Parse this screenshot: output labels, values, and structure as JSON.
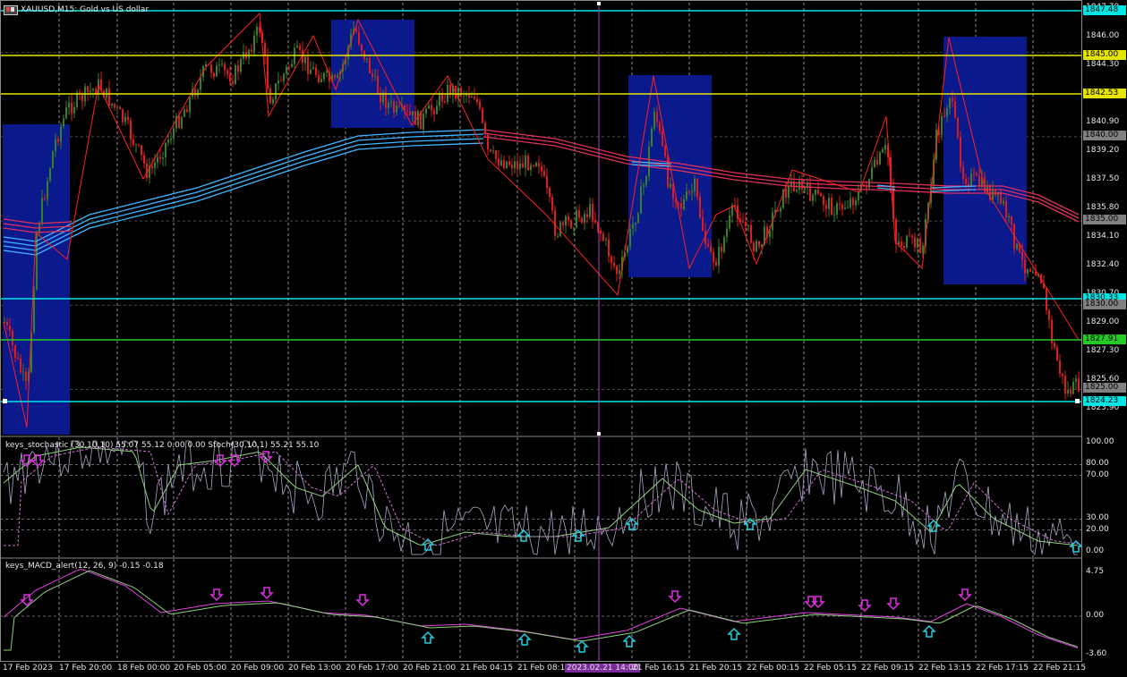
{
  "window": {
    "title": "XAUUSD,M15: Gold vs US dollar",
    "menu_icon": "chart-window-icon"
  },
  "main_axis": {
    "ticks": [
      "1847.70",
      "1846.00",
      "1844.30",
      "1842.60",
      "1840.90",
      "1839.20",
      "1837.50",
      "1835.80",
      "1834.10",
      "1832.40",
      "1830.70",
      "1829.00",
      "1827.30",
      "1825.60",
      "1823.90"
    ]
  },
  "price_lines": [
    {
      "label": "1847.48",
      "color": "#00e5e5"
    },
    {
      "label": "1845.00",
      "color": "#e5e500"
    },
    {
      "label": "1842.53",
      "color": "#e5e500"
    },
    {
      "label": "1840.00",
      "color": "#808080"
    },
    {
      "label": "1835.00",
      "color": "#808080"
    },
    {
      "label": "1830.33",
      "color": "#00e5e5"
    },
    {
      "label": "1830.00",
      "color": "#808080"
    },
    {
      "label": "1827.91",
      "color": "#22cc22"
    },
    {
      "label": "1825.00",
      "color": "#808080"
    },
    {
      "label": "1824.23",
      "color": "#00e5e5"
    }
  ],
  "stochastic": {
    "title": "keys_stochastic (30,10,10) 55.07 55.12 0.00 0.00 Stoch(30,10,1) 55.21 55.10",
    "ticks": [
      "100.00",
      "80.00",
      "70.00",
      "30.00",
      "20.00",
      "0.00"
    ]
  },
  "macd": {
    "title": "keys_MACD_alert(12, 26, 9) -0.15 -0.18",
    "ticks": [
      "4.75",
      "0.00",
      "-3.60"
    ]
  },
  "time_axis": {
    "labels": [
      "17 Feb 2023",
      "17 Feb 20:00",
      "18 Feb 00:00",
      "20 Feb 05:00",
      "20 Feb 09:00",
      "20 Feb 13:00",
      "20 Feb 17:00",
      "20 Feb 21:00",
      "21 Feb 04:15",
      "21 Feb 08:15",
      "2023.02.21 14:00",
      "21 Feb 16:15",
      "21 Feb 20:15",
      "22 Feb 00:15",
      "22 Feb 05:15",
      "22 Feb 09:15",
      "22 Feb 13:15",
      "22 Feb 17:15",
      "22 Feb 21:15"
    ],
    "crosshair_label": "2023.02.21 14:00"
  },
  "colors": {
    "background": "#000000",
    "bull": "#3a7d2a",
    "bear": "#e01b1b",
    "zone": "#0a1a8c",
    "ma_blue": "#3fb6ff",
    "ma_red": "#e0305a",
    "crosshair": "#b040c0",
    "arrow_down": "#e030e0",
    "arrow_up": "#20d0e0"
  }
}
